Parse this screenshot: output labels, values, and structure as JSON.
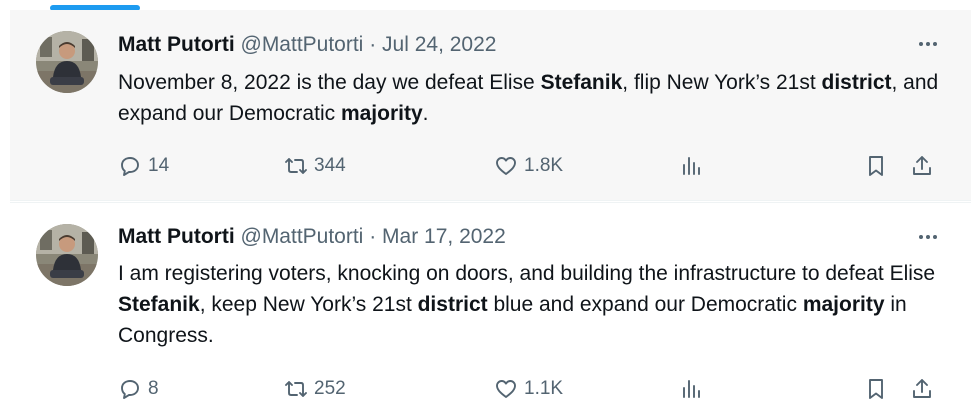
{
  "colors": {
    "accent": "#1d9bf0",
    "secondary_text": "#536471",
    "primary_text": "#0f1419"
  },
  "tweets": [
    {
      "name": "Matt Putorti",
      "handle": "@MattPutorti",
      "separator": "·",
      "date": "Jul 24, 2022",
      "text": [
        {
          "t": "November 8, 2022 is the day we defeat Elise ",
          "b": false
        },
        {
          "t": "Stefanik",
          "b": true
        },
        {
          "t": ", flip New York’s 21st ",
          "b": false
        },
        {
          "t": "district",
          "b": true
        },
        {
          "t": ", and expand our Democratic ",
          "b": false
        },
        {
          "t": "majority",
          "b": true
        },
        {
          "t": ".",
          "b": false
        }
      ],
      "replies": "14",
      "retweets": "344",
      "likes": "1.8K"
    },
    {
      "name": "Matt Putorti",
      "handle": "@MattPutorti",
      "separator": "·",
      "date": "Mar 17, 2022",
      "text": [
        {
          "t": "I am registering voters, knocking on doors, and building the infrastructure to defeat Elise ",
          "b": false
        },
        {
          "t": "Stefanik",
          "b": true
        },
        {
          "t": ", keep New York’s 21st ",
          "b": false
        },
        {
          "t": "district",
          "b": true
        },
        {
          "t": " blue and expand our Democratic ",
          "b": false
        },
        {
          "t": "majority",
          "b": true
        },
        {
          "t": " in Congress.",
          "b": false
        }
      ],
      "replies": "8",
      "retweets": "252",
      "likes": "1.1K"
    }
  ],
  "icons": [
    "more-icon",
    "reply-icon",
    "retweet-icon",
    "like-icon",
    "views-icon",
    "bookmark-icon",
    "share-icon"
  ]
}
